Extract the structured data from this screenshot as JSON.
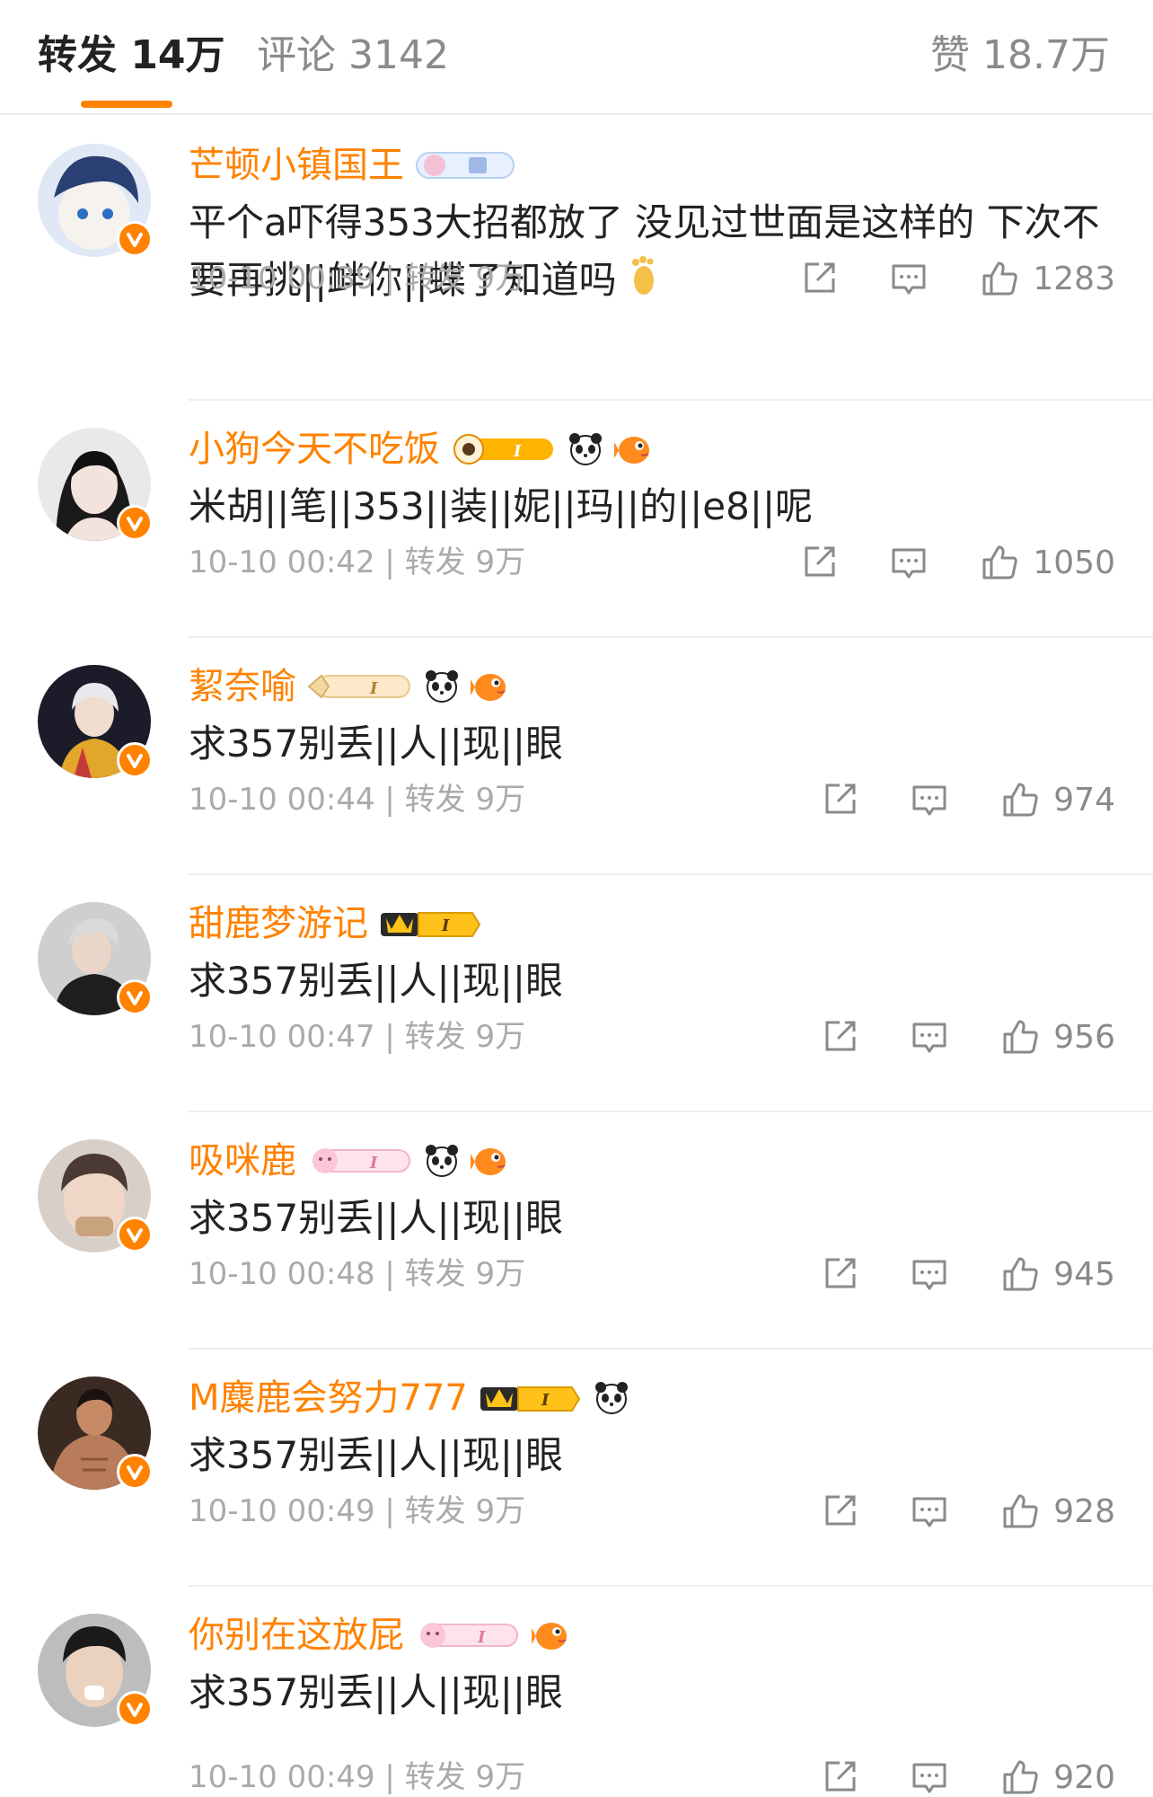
{
  "tabs": {
    "repost": "转发 14万",
    "comment": "评论 3142",
    "like": "赞 18.7万"
  },
  "colors": {
    "accent": "#ff8200",
    "username": "#ff8200",
    "meta": "#aaaaaa"
  },
  "icons": [
    "verified-badge-icon",
    "edit-icon",
    "comment-icon",
    "thumbs-up-icon",
    "foot-emoji-icon",
    "panda-emoji-icon",
    "fish-emoji-icon"
  ],
  "comments": [
    {
      "username": "芒顿小镇国王",
      "text": "平个a吓得353大招都放了 没见过世面是这样的 下次不要再挑||衅你||蝶了知道吗",
      "date": "10-10 00:39",
      "repost": "转发 9万",
      "likes": "1283"
    },
    {
      "username": "小狗今天不吃饭",
      "text": "米胡||笔||353||装||妮||玛||的||e8||呢",
      "date": "10-10 00:42",
      "repost": "转发 9万",
      "likes": "1050"
    },
    {
      "username": "絜奈喻",
      "text": "求357别丢||人||现||眼",
      "date": "10-10 00:44",
      "repost": "转发 9万",
      "likes": "974"
    },
    {
      "username": "甜鹿梦游记",
      "text": "求357别丢||人||现||眼",
      "date": "10-10 00:47",
      "repost": "转发 9万",
      "likes": "956"
    },
    {
      "username": "吸咪鹿",
      "text": "求357别丢||人||现||眼",
      "date": "10-10 00:48",
      "repost": "转发 9万",
      "likes": "945"
    },
    {
      "username": "M麋鹿会努力777",
      "text": "求357别丢||人||现||眼",
      "date": "10-10 00:49",
      "repost": "转发 9万",
      "likes": "928"
    },
    {
      "username": "你别在这放屁",
      "text": "求357别丢||人||现||眼",
      "date": "10-10 00:49",
      "repost": "转发 9万",
      "likes": "920"
    }
  ]
}
